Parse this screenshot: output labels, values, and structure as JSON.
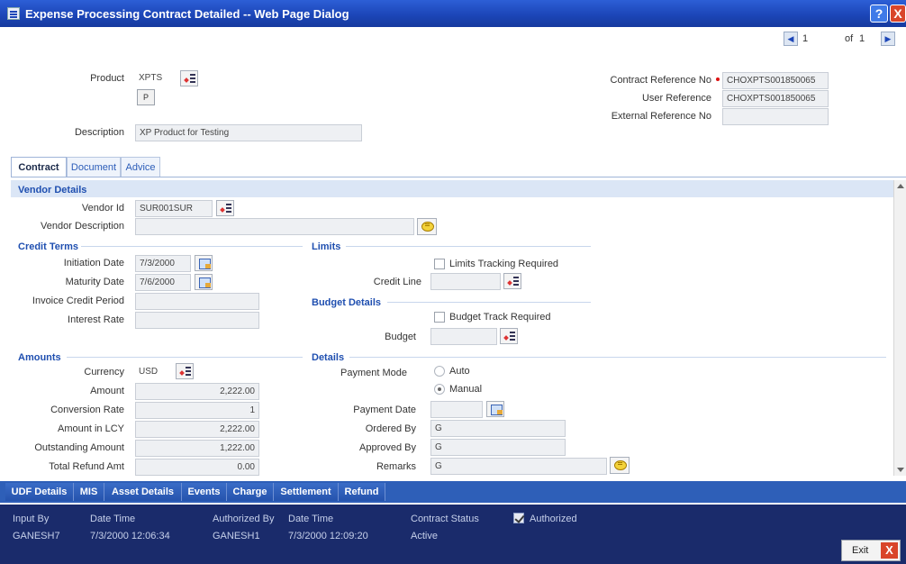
{
  "window": {
    "title": "Expense Processing Contract Detailed -- Web Page Dialog",
    "help_icon": "help-icon",
    "close_icon": "close-icon",
    "help_glyph": "?",
    "close_glyph": "X"
  },
  "pager": {
    "current": "1",
    "of_label": "of",
    "total": "1"
  },
  "header": {
    "product_label": "Product",
    "product_value": "XPTS",
    "p_button": "P",
    "description_label": "Description",
    "description_value": "XP Product for Testing",
    "contract_ref_label": "Contract Reference No",
    "contract_ref_value": "CHOXPTS001850065",
    "user_ref_label": "User Reference",
    "user_ref_value": "CHOXPTS001850065",
    "external_ref_label": "External Reference No",
    "external_ref_value": ""
  },
  "tabs": [
    {
      "label": "Contract",
      "active": true
    },
    {
      "label": "Document",
      "active": false
    },
    {
      "label": "Advice",
      "active": false
    }
  ],
  "vendor": {
    "section_title": "Vendor Details",
    "vendor_id_label": "Vendor Id",
    "vendor_id_value": "SUR001SUR",
    "vendor_desc_label": "Vendor Description",
    "vendor_desc_value": ""
  },
  "credit_terms": {
    "section_title": "Credit Terms",
    "initiation_label": "Initiation Date",
    "initiation_value": "7/3/2000",
    "maturity_label": "Maturity Date",
    "maturity_value": "7/6/2000",
    "invoice_period_label": "Invoice Credit Period",
    "invoice_period_value": "",
    "interest_label": "Interest Rate",
    "interest_value": ""
  },
  "limits": {
    "section_title": "Limits",
    "tracking_label": "Limits Tracking Required",
    "credit_line_label": "Credit Line",
    "credit_line_value": ""
  },
  "budget": {
    "section_title": "Budget Details",
    "track_label": "Budget Track Required",
    "budget_label": "Budget",
    "budget_value": ""
  },
  "amounts": {
    "section_title": "Amounts",
    "currency_label": "Currency",
    "currency_value": "USD",
    "amount_label": "Amount",
    "amount_value": "2,222.00",
    "conversion_label": "Conversion Rate",
    "conversion_value": "1",
    "lcy_label": "Amount in LCY",
    "lcy_value": "2,222.00",
    "outstanding_label": "Outstanding Amount",
    "outstanding_value": "1,222.00",
    "refund_label": "Total Refund Amt",
    "refund_value": "0.00"
  },
  "details": {
    "section_title": "Details",
    "payment_mode_label": "Payment Mode",
    "mode_auto": "Auto",
    "mode_manual": "Manual",
    "payment_date_label": "Payment Date",
    "payment_date_value": "",
    "ordered_by_label": "Ordered By",
    "ordered_by_value": "G",
    "approved_by_label": "Approved By",
    "approved_by_value": "G",
    "remarks_label": "Remarks",
    "remarks_value": "G"
  },
  "subsystem_buttons": [
    "UDF Details",
    "MIS",
    "Asset Details",
    "Events",
    "Charge",
    "Settlement",
    "Refund"
  ],
  "audit": {
    "input_by_label": "Input By",
    "input_by_value": "GANESH7",
    "date_time_label": "Date Time",
    "input_date_value": "7/3/2000 12:06:34",
    "authorized_by_label": "Authorized By",
    "authorized_by_value": "GANESH1",
    "auth_date_label": "Date Time",
    "auth_date_value": "7/3/2000 12:09:20",
    "status_label": "Contract Status",
    "status_value": "Active",
    "authorized_label": "Authorized"
  },
  "exit_label": "Exit",
  "exit_glyph": "X"
}
